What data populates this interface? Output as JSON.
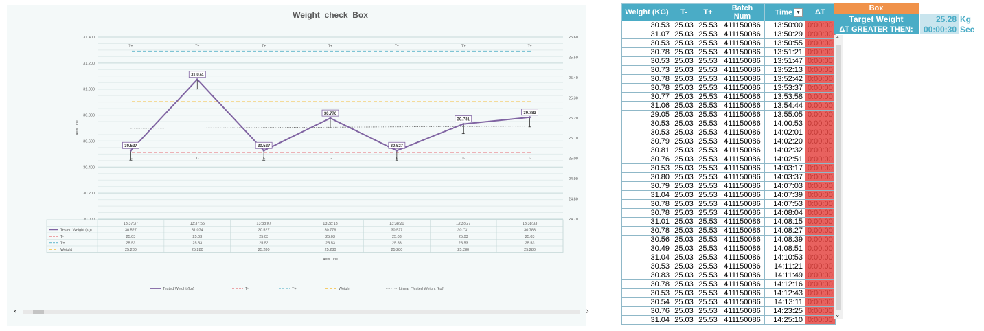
{
  "chart_data": {
    "type": "line",
    "title": "Weight_check_Box",
    "xlabel": "Axis Title",
    "ylabel": "Axis Title",
    "categories": [
      "13:37:37",
      "13:37:55",
      "13:38:07",
      "13:38:13",
      "13:38:20",
      "13:38:27",
      "13:38:33"
    ],
    "ylim": [
      30.0,
      31.4
    ],
    "y_ticks": [
      "30.000",
      "30.200",
      "30.400",
      "30.600",
      "30.800",
      "31.000",
      "31.200",
      "31.400"
    ],
    "y2lim": [
      24.7,
      25.6
    ],
    "y2_ticks": [
      "24.70",
      "24.80",
      "24.90",
      "25.00",
      "25.10",
      "25.20",
      "25.30",
      "25.40",
      "25.50",
      "25.60"
    ],
    "grid": true,
    "legend_position": "bottom",
    "series": [
      {
        "name": "Tested Weight (kg)",
        "values": [
          30.527,
          31.074,
          30.527,
          30.776,
          30.527,
          30.731,
          30.783
        ],
        "labels": [
          "30.527",
          "31.074",
          "30.527",
          "30.776",
          "30.527",
          "30.731",
          "30.783"
        ],
        "color": "#8064a2",
        "axis": "left"
      },
      {
        "name": "T-",
        "values": [
          25.03,
          25.03,
          25.03,
          25.03,
          25.03,
          25.03,
          25.03
        ],
        "labels": [
          "25.03",
          "25.03",
          "25.03",
          "25.03",
          "25.03",
          "25.03",
          "25.03"
        ],
        "color": "#e8888e",
        "axis": "right"
      },
      {
        "name": "T+",
        "values": [
          25.53,
          25.53,
          25.53,
          25.53,
          25.53,
          25.53,
          25.53
        ],
        "labels": [
          "25.53",
          "25.53",
          "25.53",
          "25.53",
          "25.53",
          "25.53",
          "25.53"
        ],
        "color": "#7fc4d4",
        "axis": "right"
      },
      {
        "name": "Weight",
        "values": [
          25.28,
          25.28,
          25.28,
          25.28,
          25.28,
          25.28,
          25.28
        ],
        "labels": [
          "25.280",
          "25.280",
          "25.280",
          "25.280",
          "25.280",
          "25.280",
          "25.280"
        ],
        "color": "#f5bd3c",
        "axis": "right"
      }
    ],
    "trendline": {
      "name": "Linear (Tested Weight (kg))",
      "color": "#555555"
    },
    "annotations": {
      "t_plus": "T+",
      "t_minus": "T-"
    }
  },
  "table": {
    "headers": {
      "weight": "Weight (KG)",
      "tminus": "T-",
      "tplus": "T+",
      "batch": "Batch Num",
      "time": "Time",
      "dt": "ΔT"
    },
    "rows": [
      [
        "30.53",
        "25.03",
        "25.53",
        "411150086",
        "13:50:00",
        "0:00:00"
      ],
      [
        "31.07",
        "25.03",
        "25.53",
        "411150086",
        "13:50:29",
        "0:00:00"
      ],
      [
        "30.53",
        "25.03",
        "25.53",
        "411150086",
        "13:50:55",
        "0:00:00"
      ],
      [
        "30.78",
        "25.03",
        "25.53",
        "411150086",
        "13:51:21",
        "0:00:00"
      ],
      [
        "30.53",
        "25.03",
        "25.53",
        "411150086",
        "13:51:47",
        "0:00:00"
      ],
      [
        "30.73",
        "25.03",
        "25.53",
        "411150086",
        "13:52:13",
        "0:00:00"
      ],
      [
        "30.78",
        "25.03",
        "25.53",
        "411150086",
        "13:52:42",
        "0:00:00"
      ],
      [
        "30.78",
        "25.03",
        "25.53",
        "411150086",
        "13:53:37",
        "0:00:00"
      ],
      [
        "30.77",
        "25.03",
        "25.53",
        "411150086",
        "13:53:58",
        "0:00:00"
      ],
      [
        "31.06",
        "25.03",
        "25.53",
        "411150086",
        "13:54:44",
        "0:00:00"
      ],
      [
        "29.05",
        "25.03",
        "25.53",
        "411150086",
        "13:55:05",
        "0:00:00"
      ],
      [
        "30.53",
        "25.03",
        "25.53",
        "411150086",
        "14:00:53",
        "0:00:00"
      ],
      [
        "30.53",
        "25.03",
        "25.53",
        "411150086",
        "14:02:01",
        "0:00:00"
      ],
      [
        "30.79",
        "25.03",
        "25.53",
        "411150086",
        "14:02:20",
        "0:00:00"
      ],
      [
        "30.81",
        "25.03",
        "25.53",
        "411150086",
        "14:02:32",
        "0:00:00"
      ],
      [
        "30.76",
        "25.03",
        "25.53",
        "411150086",
        "14:02:51",
        "0:00:00"
      ],
      [
        "30.53",
        "25.03",
        "25.53",
        "411150086",
        "14:03:17",
        "0:00:00"
      ],
      [
        "30.80",
        "25.03",
        "25.53",
        "411150086",
        "14:03:37",
        "0:00:00"
      ],
      [
        "30.79",
        "25.03",
        "25.53",
        "411150086",
        "14:07:03",
        "0:00:00"
      ],
      [
        "31.04",
        "25.03",
        "25.53",
        "411150086",
        "14:07:39",
        "0:00:00"
      ],
      [
        "30.78",
        "25.03",
        "25.53",
        "411150086",
        "14:07:53",
        "0:00:00"
      ],
      [
        "30.78",
        "25.03",
        "25.53",
        "411150086",
        "14:08:04",
        "0:00:00"
      ],
      [
        "31.01",
        "25.03",
        "25.53",
        "411150086",
        "14:08:15",
        "0:00:00"
      ],
      [
        "30.78",
        "25.03",
        "25.53",
        "411150086",
        "14:08:27",
        "0:00:00"
      ],
      [
        "30.56",
        "25.03",
        "25.53",
        "411150086",
        "14:08:39",
        "0:00:00"
      ],
      [
        "30.49",
        "25.03",
        "25.53",
        "411150086",
        "14:08:51",
        "0:00:00"
      ],
      [
        "31.04",
        "25.03",
        "25.53",
        "411150086",
        "14:10:53",
        "0:00:00"
      ],
      [
        "30.53",
        "25.03",
        "25.53",
        "411150086",
        "14:11:21",
        "0:00:00"
      ],
      [
        "30.83",
        "25.03",
        "25.53",
        "411150086",
        "14:11:49",
        "0:00:00"
      ],
      [
        "30.78",
        "25.03",
        "25.53",
        "411150086",
        "14:12:16",
        "0:00:00"
      ],
      [
        "30.53",
        "25.03",
        "25.53",
        "411150086",
        "14:12:43",
        "0:00:00"
      ],
      [
        "30.54",
        "25.03",
        "25.53",
        "411150086",
        "14:13:11",
        "0:00:00"
      ],
      [
        "30.76",
        "25.03",
        "25.53",
        "411150086",
        "14:23:25",
        "0:00:00"
      ],
      [
        "31.04",
        "25.03",
        "25.53",
        "411150086",
        "14:25:10",
        "0:00:00"
      ]
    ]
  },
  "side": {
    "box_title": "Box",
    "target_weight_label": "Target Weight",
    "target_weight_value": "25.28",
    "target_weight_unit": "Kg",
    "dt_label": "ΔT GREATER THEN:",
    "dt_value": "00:00:30",
    "dt_unit": "Sec"
  },
  "colors": {
    "header_bg": "#4aacc6",
    "dt_cell_bg": "#e8625f",
    "box_header_bg": "#f0924a",
    "value_cell_bg": "#c9e5ee"
  },
  "icons": {
    "filter": "filter-dropdown-icon",
    "scroll_left": "chevron-left-icon",
    "scroll_right": "chevron-right-icon",
    "scroll_up": "chevron-up-icon",
    "scroll_down": "chevron-down-icon"
  }
}
